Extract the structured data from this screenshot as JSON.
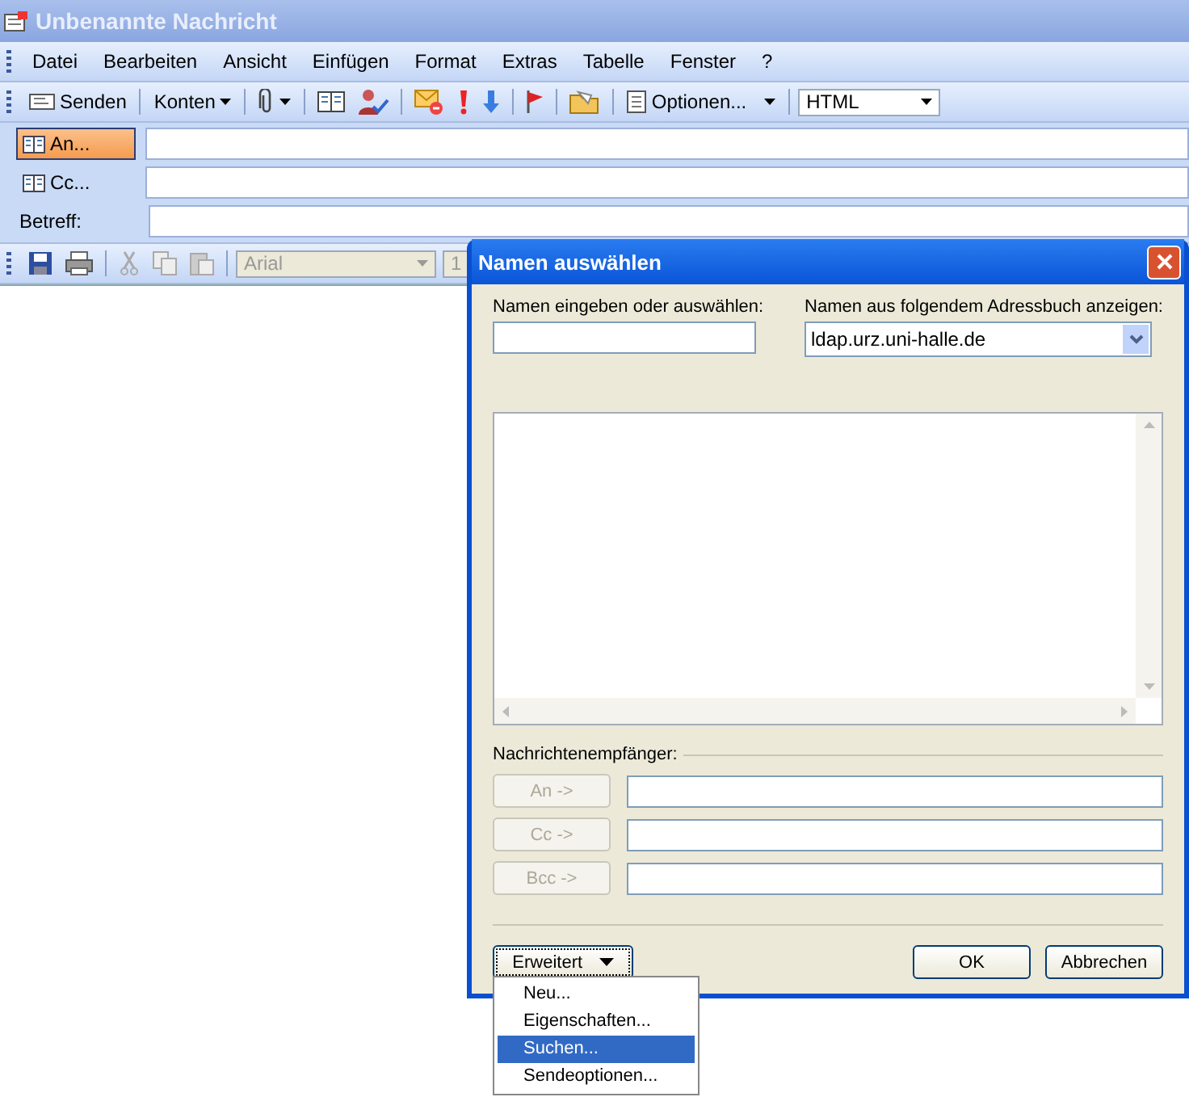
{
  "window": {
    "title": "Unbenannte Nachricht"
  },
  "menu": [
    "Datei",
    "Bearbeiten",
    "Ansicht",
    "Einfügen",
    "Format",
    "Extras",
    "Tabelle",
    "Fenster",
    "?"
  ],
  "toolbar": {
    "send": "Senden",
    "accounts": "Konten",
    "options": "Optionen...",
    "format": "HTML"
  },
  "header_fields": [
    {
      "label": "An...",
      "kind": "button",
      "selected": true
    },
    {
      "label": "Cc...",
      "kind": "button",
      "selected": false
    },
    {
      "label": "Betreff:",
      "kind": "label",
      "selected": false
    }
  ],
  "format_toolbar": {
    "font": "Arial",
    "size": "1"
  },
  "dialog": {
    "title": "Namen auswählen",
    "name_label": "Namen eingeben oder auswählen:",
    "book_label": "Namen aus folgendem Adressbuch anzeigen:",
    "book": "ldap.urz.uni-halle.de",
    "recipients_label": "Nachrichtenempfänger:",
    "recipients": [
      {
        "button": "An ->",
        "disabled": true
      },
      {
        "button": "Cc ->",
        "disabled": true
      },
      {
        "button": "Bcc ->",
        "disabled": true
      }
    ],
    "advanced": "Erweitert",
    "ok": "OK",
    "cancel": "Abbrechen"
  },
  "advanced_menu": [
    {
      "label": "Neu...",
      "selected": false
    },
    {
      "label": "Eigenschaften...",
      "selected": false
    },
    {
      "label": "Suchen...",
      "selected": true
    },
    {
      "label": "Sendeoptionen...",
      "selected": false
    }
  ]
}
